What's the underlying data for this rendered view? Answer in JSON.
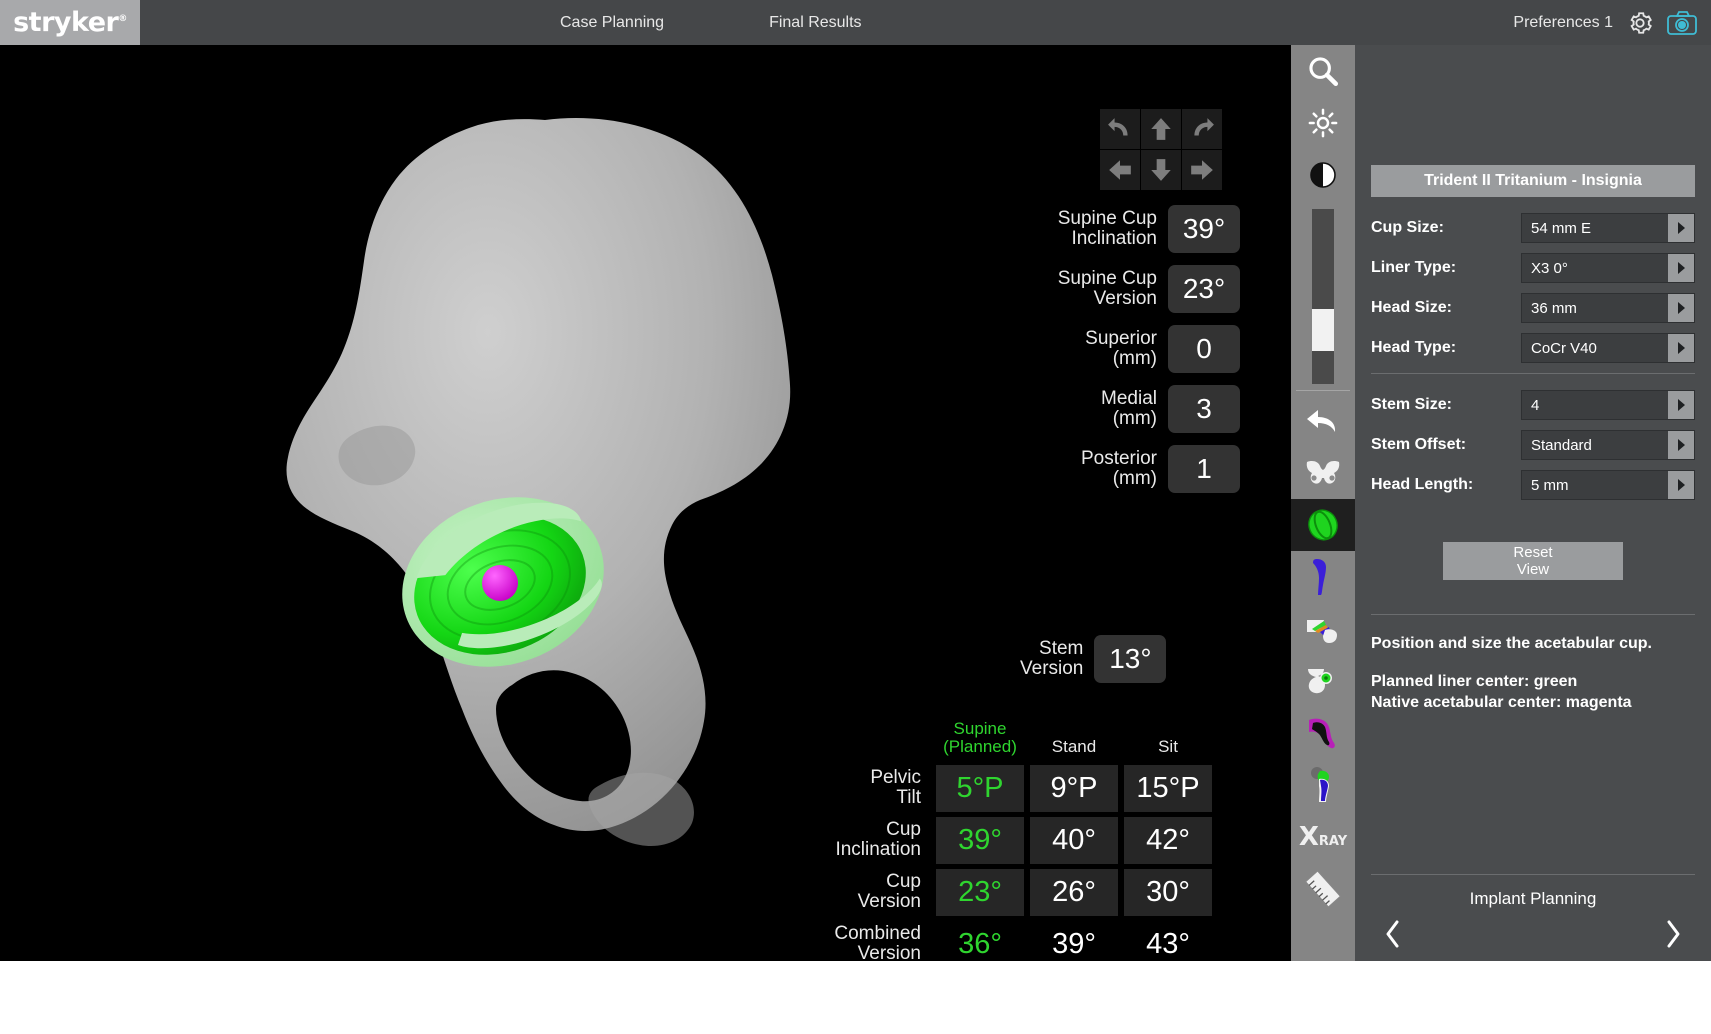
{
  "header": {
    "logo": "stryker",
    "logo_registered": "®",
    "tabs": [
      {
        "label": "Case Planning"
      },
      {
        "label": "Final Results"
      }
    ],
    "preferences_label": "Preferences 1",
    "gear_icon": "gear-icon",
    "capture_icon": "camera-icon",
    "accent_teal": "#3fbcd4"
  },
  "viewport": {
    "arrow_pad": [
      {
        "name": "rotate-left-icon"
      },
      {
        "name": "arrow-up-icon"
      },
      {
        "name": "rotate-right-icon"
      },
      {
        "name": "arrow-left-icon"
      },
      {
        "name": "arrow-down-icon"
      },
      {
        "name": "arrow-right-icon"
      }
    ],
    "readouts": [
      {
        "label": "Supine Cup\nInclination",
        "value": "39°"
      },
      {
        "label": "Supine Cup\nVersion",
        "value": "23°"
      },
      {
        "label": "Superior\n(mm)",
        "value": "0"
      },
      {
        "label": "Medial\n(mm)",
        "value": "3"
      },
      {
        "label": "Posterior\n(mm)",
        "value": "1"
      }
    ],
    "stem_version": {
      "label": "Stem\nVersion",
      "value": "13°"
    },
    "model": {
      "bone_color": "#b4b4b4",
      "cup_color": "#1fd41f",
      "liner_color": "#9ee89e",
      "native_center_color": "#e019e0"
    }
  },
  "measurement_table": {
    "columns": [
      "Supine\n(Planned)",
      "Stand",
      "Sit"
    ],
    "planned_color": "#2fd52f",
    "rows": [
      {
        "label": "Pelvic\nTilt",
        "values": [
          "5°P",
          "9°P",
          "15°P"
        ],
        "boxed": true
      },
      {
        "label": "Cup\nInclination",
        "values": [
          "39°",
          "40°",
          "42°"
        ],
        "boxed": true
      },
      {
        "label": "Cup\nVersion",
        "values": [
          "23°",
          "26°",
          "30°"
        ],
        "boxed": true
      },
      {
        "label": "Combined\nVersion",
        "values": [
          "36°",
          "39°",
          "43°"
        ],
        "boxed": false
      }
    ]
  },
  "toolbar": {
    "items": [
      {
        "name": "zoom-search-icon",
        "selected": false
      },
      {
        "name": "brightness-icon",
        "selected": false
      },
      {
        "name": "contrast-icon",
        "selected": false
      },
      {
        "name": "opacity-slider",
        "selected": false
      },
      {
        "name": "undo-icon",
        "selected": false
      },
      {
        "name": "pelvis-icon",
        "selected": false
      },
      {
        "name": "acetabular-cup-icon",
        "selected": true
      },
      {
        "name": "femoral-stem-icon",
        "selected": false
      },
      {
        "name": "resection-plane-icon",
        "selected": false
      },
      {
        "name": "acetabulum-center-icon",
        "selected": false
      },
      {
        "name": "native-hip-icon",
        "selected": false
      },
      {
        "name": "implant-assembly-icon",
        "selected": false
      },
      {
        "name": "xray-icon",
        "selected": false
      },
      {
        "name": "ruler-icon",
        "selected": false
      }
    ],
    "xray_label_x": "X",
    "xray_label_ray": "RAY"
  },
  "panel": {
    "implant_title": "Trident II Tritanium - Insignia",
    "cup_fields": [
      {
        "label": "Cup Size:",
        "value": "54 mm E"
      },
      {
        "label": "Liner Type:",
        "value": "X3 0°"
      },
      {
        "label": "Head Size:",
        "value": "36 mm"
      },
      {
        "label": "Head Type:",
        "value": "CoCr V40"
      }
    ],
    "stem_fields": [
      {
        "label": "Stem Size:",
        "value": "4"
      },
      {
        "label": "Stem Offset:",
        "value": "Standard"
      },
      {
        "label": "Head Length:",
        "value": "5 mm"
      }
    ],
    "reset_button": {
      "line1": "Reset",
      "line2": "View"
    },
    "info": {
      "line1": "Position and size the acetabular cup.",
      "line2": "Planned liner center: green",
      "line3": "Native acetabular center: magenta"
    },
    "footer_title": "Implant Planning",
    "prev_icon": "chevron-left-icon",
    "next_icon": "chevron-right-icon"
  }
}
